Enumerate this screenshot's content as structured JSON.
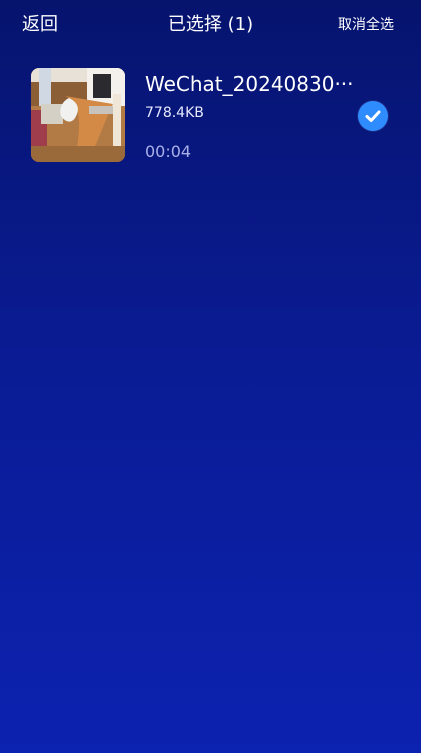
{
  "header": {
    "back_label": "返回",
    "title": "已选择 (1)",
    "deselect_all_label": "取消全选"
  },
  "files": [
    {
      "name": "WeChat_20240830···",
      "size": "778.4KB",
      "duration": "00:04",
      "selected": true,
      "thumbnail_icon": "video-thumbnail",
      "check_icon": "checkmark-icon"
    }
  ],
  "colors": {
    "background_top": "#06146e",
    "background_bottom": "#0c22b0",
    "accent": "#2f8cff",
    "secondary_text": "#a9b0e8"
  }
}
